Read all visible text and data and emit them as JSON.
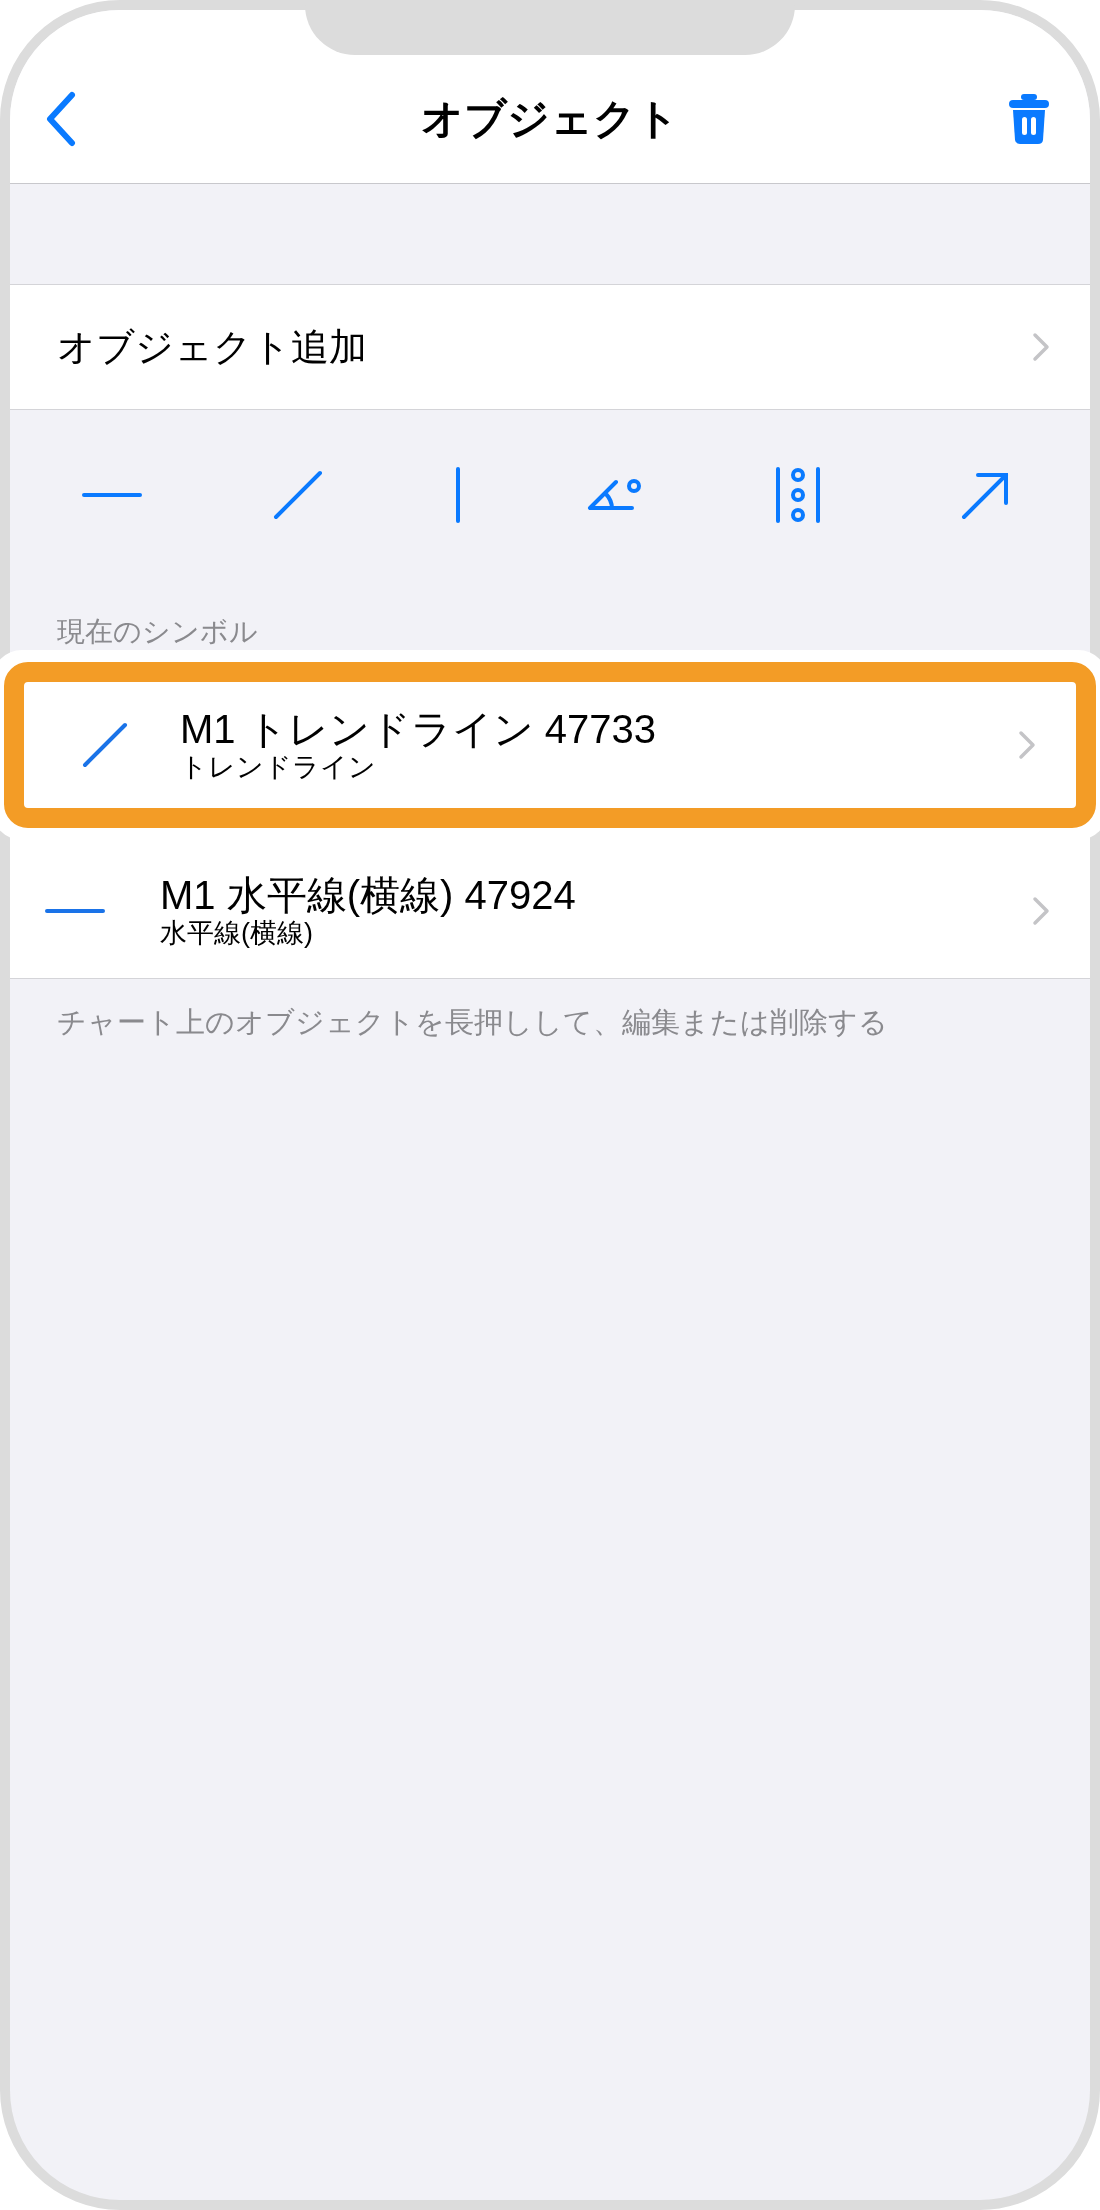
{
  "nav": {
    "title": "オブジェクト"
  },
  "add_row": {
    "label": "オブジェクト追加"
  },
  "tools": [
    {
      "kind": "horizontal"
    },
    {
      "kind": "trend"
    },
    {
      "kind": "vertical"
    },
    {
      "kind": "angle"
    },
    {
      "kind": "cycle"
    },
    {
      "kind": "arrow"
    }
  ],
  "symbols": {
    "header": "現在のシンボル",
    "rows": [
      {
        "kind": "trend",
        "title": "M1 トレンドライン 47733",
        "subtitle": "トレンドライン",
        "highlighted": true
      },
      {
        "kind": "horizontal",
        "title": "M1 水平線(横線) 47924",
        "subtitle": "水平線(横線)",
        "highlighted": false
      }
    ],
    "footer": "チャート上のオブジェクトを長押しして、編集または削除する"
  }
}
